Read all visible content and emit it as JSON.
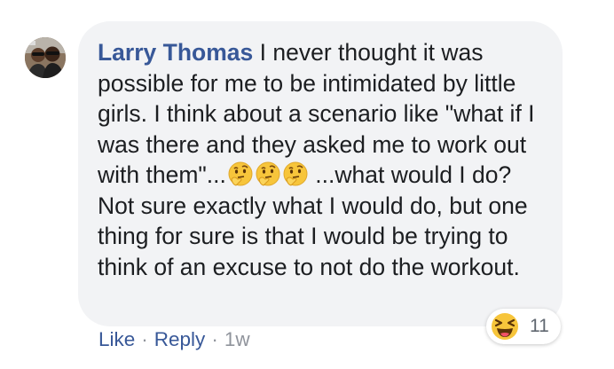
{
  "comment": {
    "author": "Larry Thomas",
    "text_part1": "I never thought it was possible for me to be intimidated by little girls. I think about a scenario like \"what if I was there and they asked me to work out with them\"...",
    "inline_emojis": [
      "thinking-face",
      "thinking-face",
      "thinking-face"
    ],
    "text_part2": "...what would I do? Not sure exactly what I would do, but one thing for sure is that I would be trying to think of an excuse to not do the workout."
  },
  "reactions": {
    "icon": "laughing-face",
    "count": "11"
  },
  "actions": {
    "like_label": "Like",
    "separator": "·",
    "reply_label": "Reply",
    "timestamp": "1w"
  },
  "colors": {
    "author_link": "#385898",
    "bubble_bg": "#f2f3f5",
    "meta_gray": "#90949c",
    "emoji_yellow": "#f7c53b"
  }
}
